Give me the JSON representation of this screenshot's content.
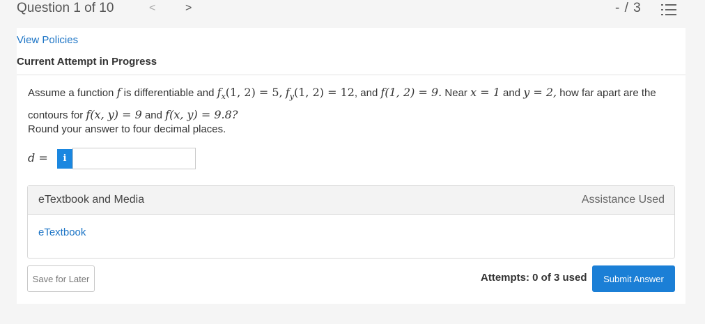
{
  "header": {
    "question_label": "Question 1 of 10",
    "prev_symbol": "<",
    "next_symbol": ">",
    "score": "- / 3",
    "list_icon": "list-icon"
  },
  "links": {
    "view_policies": "View Policies"
  },
  "attempt": {
    "heading": "Current Attempt in Progress"
  },
  "question": {
    "prefix": "Assume a function ",
    "func_f": "f",
    "middle1": " is differentiable and ",
    "fx_expr": "fx(1, 2) = 5,",
    "fy_expr": "fy(1, 2) = 12",
    "middle2": ", and ",
    "f_expr": "f(1, 2) = 9.",
    "near": " Near ",
    "x_expr": "x = 1",
    "and": " and ",
    "y_expr": "y = 2,",
    "how_far": " how far apart are the contours for ",
    "contour1": "f(x, y) = 9",
    "and2": " and ",
    "contour2": "f(x, y) = 9.8?",
    "instruction": "Round your answer to four decimal places."
  },
  "answer": {
    "label_var": "d",
    "label_eq": " =",
    "info_symbol": "i",
    "value": ""
  },
  "media": {
    "title": "eTextbook and Media",
    "assistance": "Assistance Used",
    "link": "eTextbook"
  },
  "footer": {
    "save_label": "Save for Later",
    "attempts_text": "Attempts: 0 of 3 used",
    "submit_label": "Submit Answer"
  },
  "colors": {
    "link": "#1a73c5",
    "submit": "#1b7fd6",
    "info": "#1a87e0"
  }
}
